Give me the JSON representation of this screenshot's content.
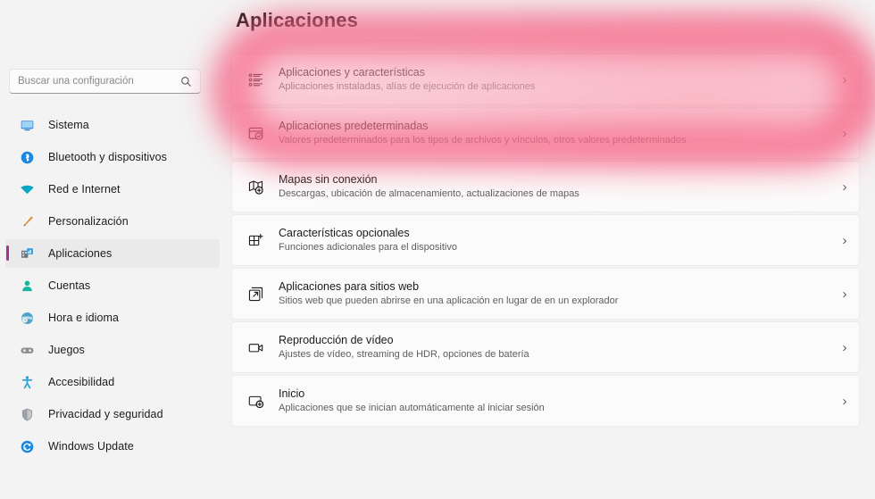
{
  "window": {
    "app_title": "Configuración",
    "background_color": "#f3f3f3",
    "card_color": "#fbfbfb"
  },
  "search": {
    "placeholder": "Buscar una configuración",
    "value": "",
    "icon": "search-icon"
  },
  "sidebar": {
    "selected_index": 4,
    "accent_color": "#a3338e",
    "items": [
      {
        "label": "Sistema",
        "icon": "monitor-icon",
        "color": "#2a7fd4"
      },
      {
        "label": "Bluetooth y dispositivos",
        "icon": "bluetooth-icon",
        "color": "#1a88e0"
      },
      {
        "label": "Red e Internet",
        "icon": "wifi-icon",
        "color": "#0aa8c0"
      },
      {
        "label": "Personalización",
        "icon": "paintbrush-icon",
        "color": "#e08a2a"
      },
      {
        "label": "Aplicaciones",
        "icon": "apps-icon",
        "color": "#3a9ad9"
      },
      {
        "label": "Cuentas",
        "icon": "person-icon",
        "color": "#19b59c"
      },
      {
        "label": "Hora e idioma",
        "icon": "globe-clock-icon",
        "color": "#4aa3c8"
      },
      {
        "label": "Juegos",
        "icon": "gamepad-icon",
        "color": "#8a8f96"
      },
      {
        "label": "Accesibilidad",
        "icon": "accessibility-icon",
        "color": "#2a9fe0"
      },
      {
        "label": "Privacidad y seguridad",
        "icon": "shield-icon",
        "color": "#9aa0a6"
      },
      {
        "label": "Windows Update",
        "icon": "update-icon",
        "color": "#1a86e0"
      }
    ]
  },
  "main": {
    "title": "Aplicaciones",
    "chevron_glyph": "›",
    "cards": [
      {
        "title": "Aplicaciones y características",
        "subtitle": "Aplicaciones instaladas, alías de ejecución de aplicaciones",
        "icon": "app-list-icon",
        "highlighted": true
      },
      {
        "title": "Aplicaciones predeterminadas",
        "subtitle": "Valores predeterminados para los tipos de archivos y vínculos, otros valores predeterminados",
        "icon": "default-apps-check-icon",
        "highlighted": true
      },
      {
        "title": "Mapas sin conexión",
        "subtitle": "Descargas, ubicación de almacenamiento, actualizaciones de mapas",
        "icon": "offline-maps-icon",
        "highlighted": false
      },
      {
        "title": "Características opcionales",
        "subtitle": "Funciones adicionales para el dispositivo",
        "icon": "optional-features-icon",
        "highlighted": false
      },
      {
        "title": "Aplicaciones para sitios web",
        "subtitle": "Sitios web que pueden abrirse en una aplicación en lugar de en un explorador",
        "icon": "web-apps-icon",
        "highlighted": false
      },
      {
        "title": "Reproducción de vídeo",
        "subtitle": "Ajustes de vídeo, streaming de HDR, opciones de batería",
        "icon": "video-playback-icon",
        "highlighted": false
      },
      {
        "title": "Inicio",
        "subtitle": "Aplicaciones que se inician automáticamente al iniciar sesión",
        "icon": "startup-apps-icon",
        "highlighted": false
      }
    ]
  },
  "annotation": {
    "type": "highlight-ring",
    "shape": "rounded-rectangle-outline",
    "color": "#f4547a",
    "targets": [
      "Aplicaciones y características",
      "Aplicaciones predeterminadas"
    ]
  }
}
